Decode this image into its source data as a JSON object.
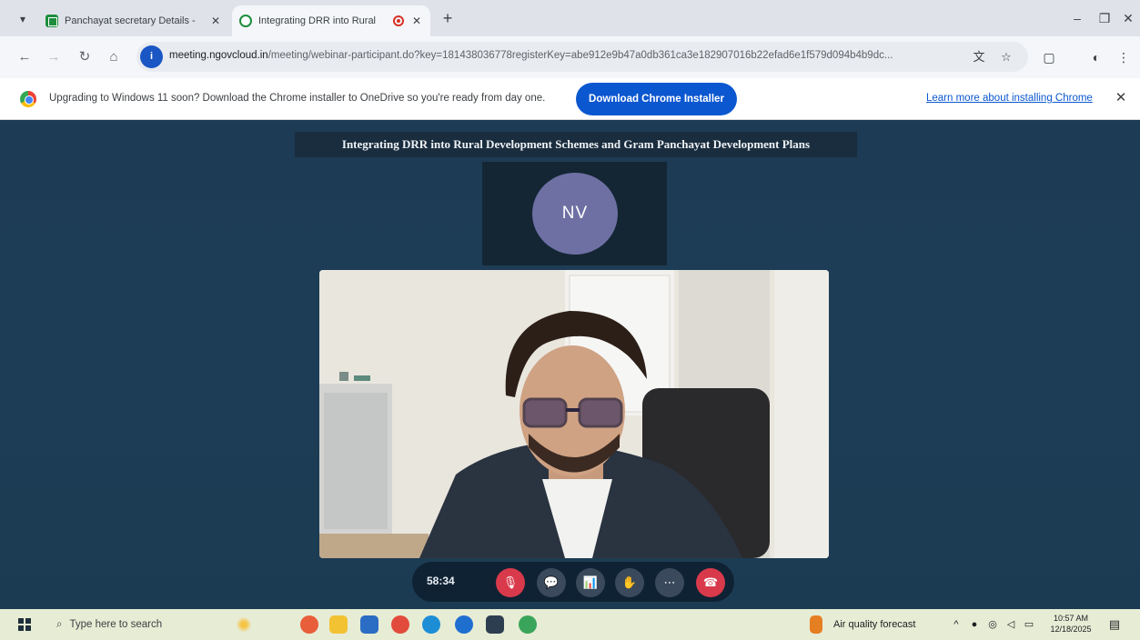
{
  "browser": {
    "tabs": [
      {
        "title": "Panchayat secretary Details - ",
        "active": false
      },
      {
        "title": "Integrating DRR into Rural",
        "active": true
      }
    ],
    "new_tab": "+",
    "window_controls": {
      "minimize": "–",
      "restore": "❐",
      "close": "✕"
    },
    "url_host": "meeting.ngovcloud.in",
    "url_path": "/meeting/webinar-participant.do?key=181438036778registerKey=abe912e9b47a0db361ca3e182907016b22efad6e1f579d094b4b9dc..."
  },
  "infobar": {
    "message": "Upgrading to Windows 11 soon? Download the Chrome installer to OneDrive so you're ready from day one.",
    "button_label": "Download Chrome Installer",
    "link_label": "Learn more about installing Chrome"
  },
  "meeting": {
    "title": "Integrating DRR into Rural Development Schemes and Gram Panchayat Development Plans",
    "presenter_initials": "NV",
    "timer": "58:34",
    "controls": [
      "mic-off",
      "chat",
      "poll",
      "raise-hand",
      "more",
      "leave-call"
    ]
  },
  "taskbar": {
    "search_placeholder": "Type here to search",
    "weather_label": "Air quality forecast",
    "clock_time": "10:57 AM",
    "clock_date": "12/18/2025"
  },
  "colors": {
    "stage_bg": "#1d3b54",
    "accent_blue": "#0b57d0",
    "leave_red": "#d93a4b",
    "avatar": "#6e70a4"
  }
}
